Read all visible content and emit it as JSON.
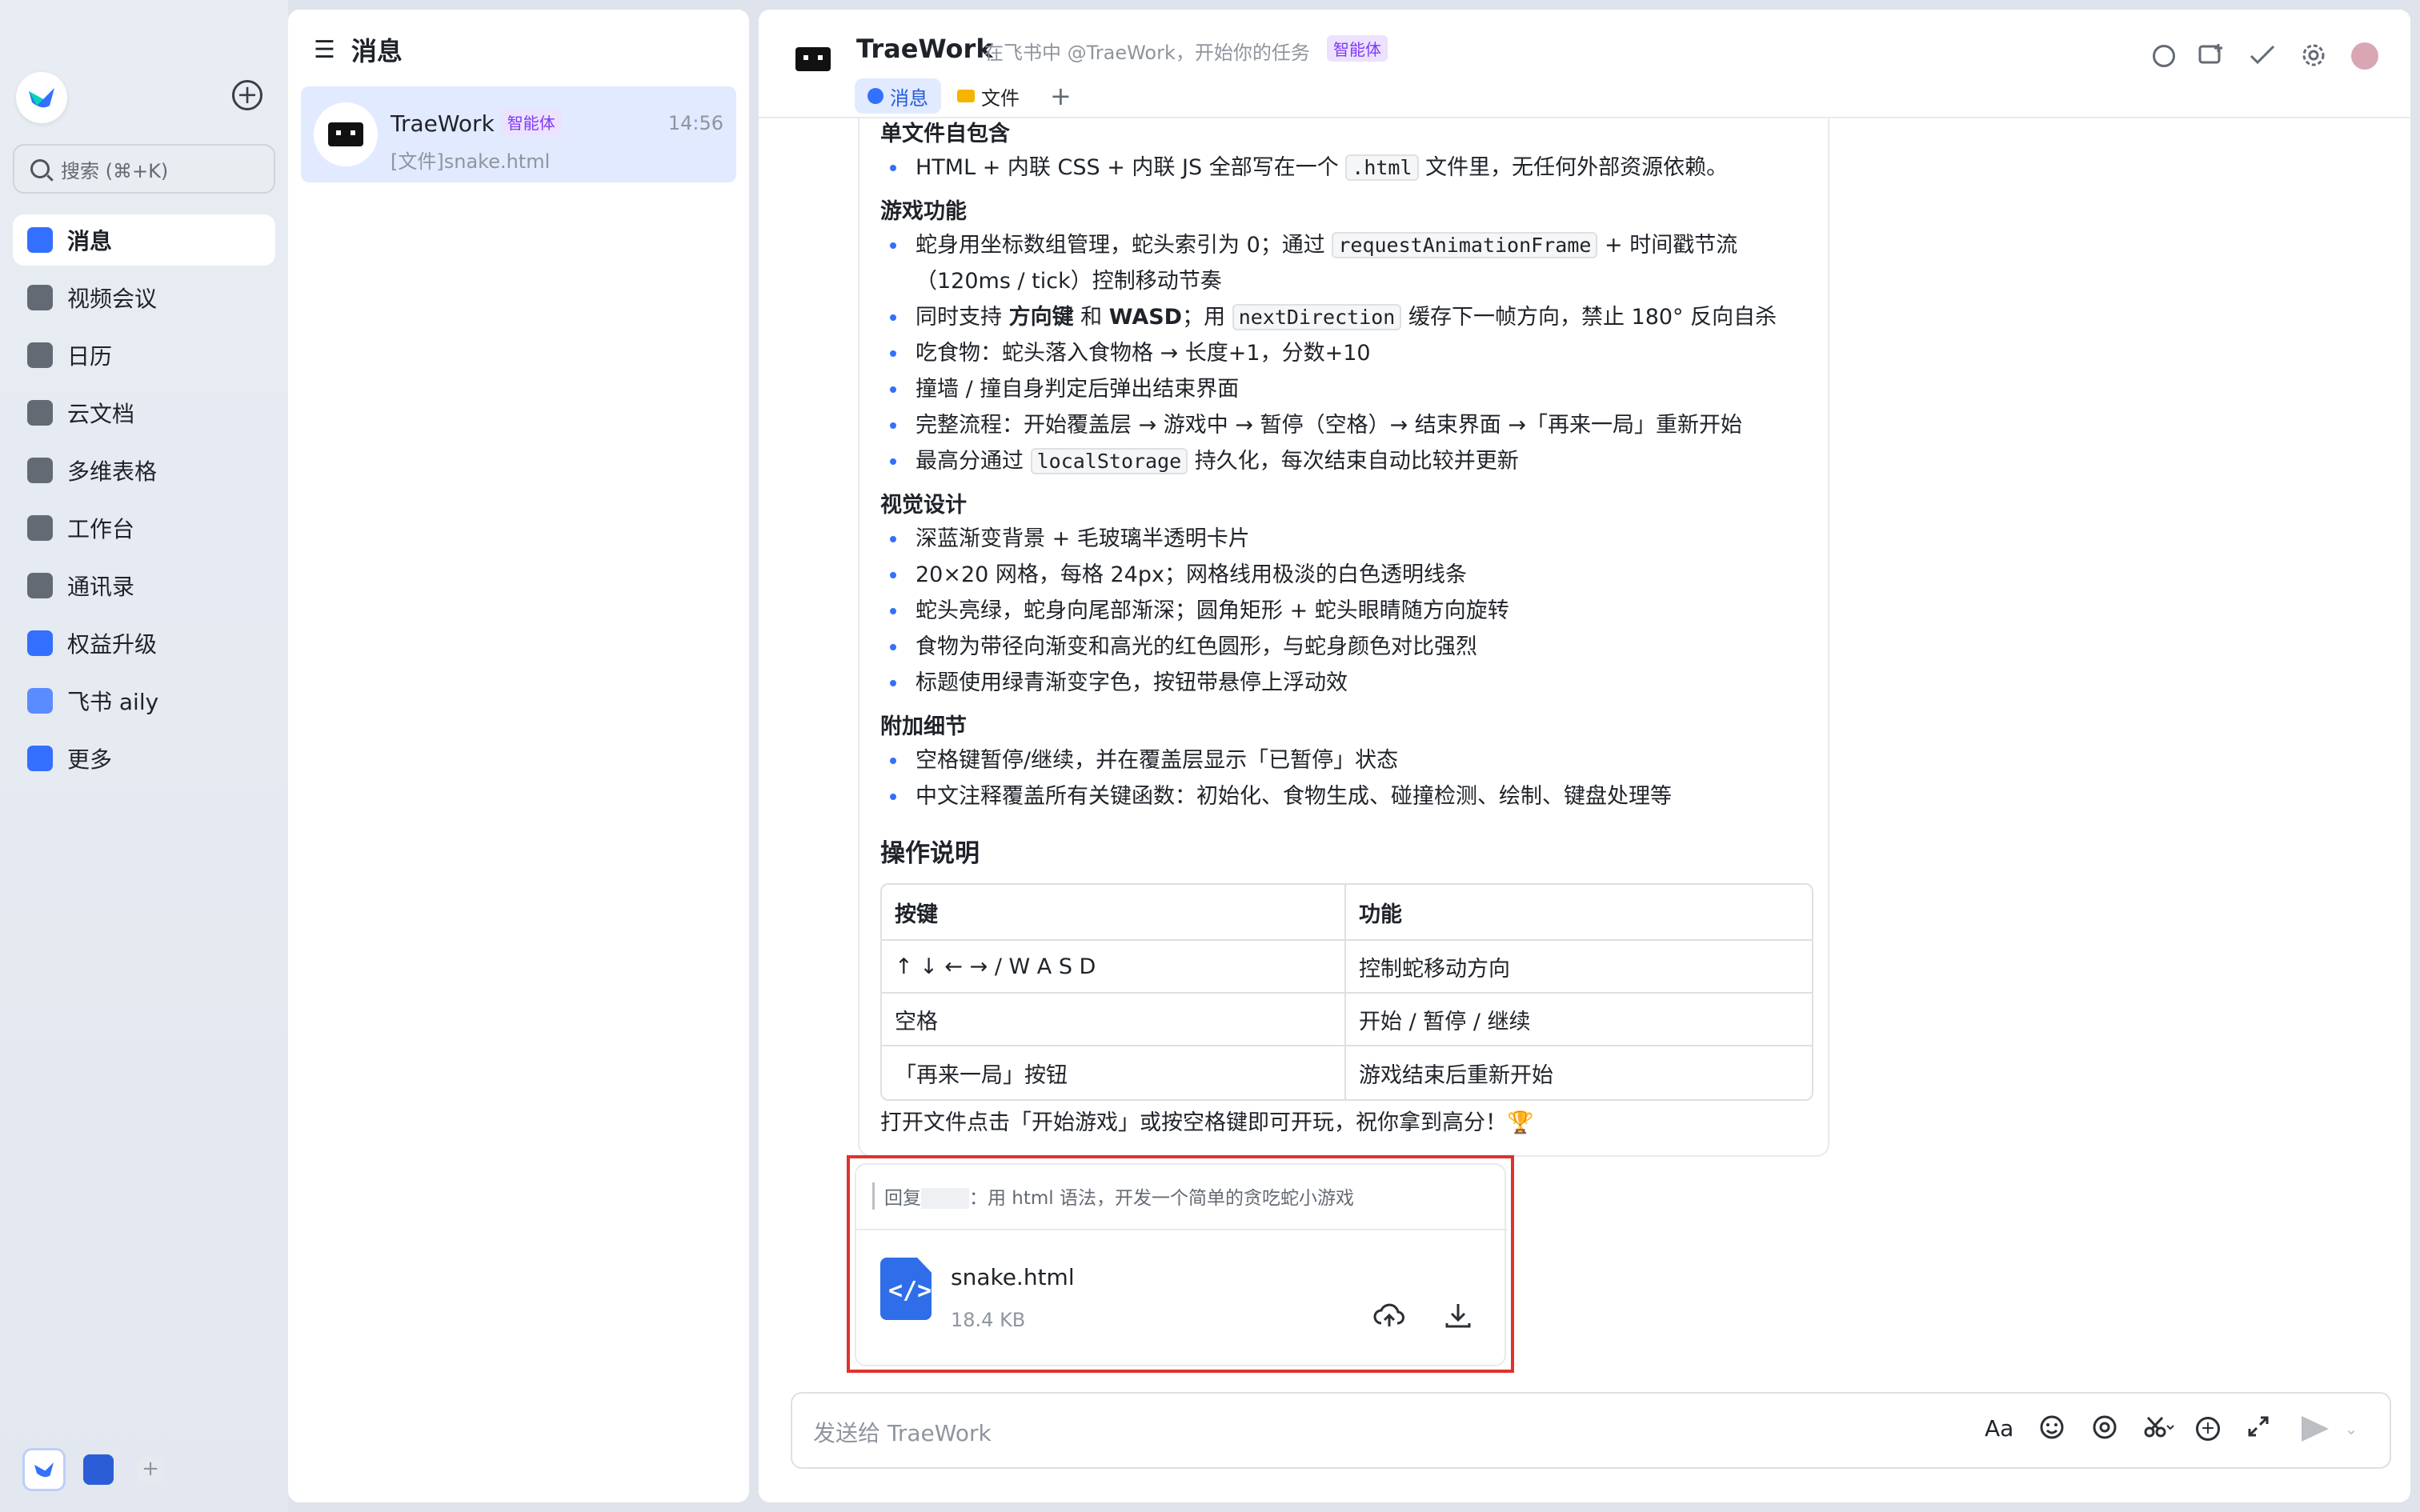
{
  "sidebar": {
    "search_placeholder": "搜索 (⌘+K)",
    "items": [
      {
        "label": "消息",
        "icon": "chat-bubble-icon",
        "color": "#3370ff"
      },
      {
        "label": "视频会议",
        "icon": "video-camera-icon",
        "color": "#646a73"
      },
      {
        "label": "日历",
        "icon": "calendar-icon",
        "color": "#646a73"
      },
      {
        "label": "云文档",
        "icon": "cloud-doc-icon",
        "color": "#646a73"
      },
      {
        "label": "多维表格",
        "icon": "base-table-icon",
        "color": "#646a73"
      },
      {
        "label": "工作台",
        "icon": "workplace-grid-icon",
        "color": "#646a73"
      },
      {
        "label": "通讯录",
        "icon": "contacts-icon",
        "color": "#646a73"
      },
      {
        "label": "权益升级",
        "icon": "diamond-icon",
        "color": "#3370ff"
      },
      {
        "label": "飞书 aily",
        "icon": "aily-icon",
        "color": "#5b8cff"
      },
      {
        "label": "更多",
        "icon": "more-apps-icon",
        "color": "#3370ff"
      }
    ]
  },
  "chatlist": {
    "title": "消息",
    "items": [
      {
        "name": "TraeWork",
        "tag": "智能体",
        "time": "14:56",
        "preview": "[文件]snake.html"
      }
    ]
  },
  "chat": {
    "title": "TraeWork",
    "subtitle": "在飞书中 @TraeWork，开始你的任务",
    "tag": "智能体",
    "tabs": [
      "消息",
      "文件"
    ],
    "tab_add": "+",
    "message": {
      "sections": [
        {
          "title": "单文件自包含",
          "items": [
            {
              "parts": [
                {
                  "t": "HTML + 内联 CSS + 内联 JS 全部写在一个 "
                },
                {
                  "code": ".html"
                },
                {
                  "t": " 文件里，无任何外部资源依赖。"
                }
              ]
            }
          ]
        },
        {
          "title": "游戏功能",
          "items": [
            {
              "parts": [
                {
                  "t": "蛇身用坐标数组管理，蛇头索引为 0；通过 "
                },
                {
                  "code": "requestAnimationFrame"
                },
                {
                  "t": " + 时间戳节流"
                }
              ]
            },
            {
              "cont": "（120ms / tick）控制移动节奏"
            },
            {
              "parts": [
                {
                  "t": "同时支持 "
                },
                {
                  "b": "方向键"
                },
                {
                  "t": " 和 "
                },
                {
                  "b": "WASD"
                },
                {
                  "t": "；用 "
                },
                {
                  "code": "nextDirection"
                },
                {
                  "t": " 缓存下一帧方向，禁止 180° 反向自杀"
                }
              ]
            },
            {
              "parts": [
                {
                  "t": "吃食物：蛇头落入食物格 → 长度+1，分数+10"
                }
              ]
            },
            {
              "parts": [
                {
                  "t": "撞墙 / 撞自身判定后弹出结束界面"
                }
              ]
            },
            {
              "parts": [
                {
                  "t": "完整流程：开始覆盖层 → 游戏中 → 暂停（空格）→ 结束界面 →「再来一局」重新开始"
                }
              ]
            },
            {
              "parts": [
                {
                  "t": "最高分通过 "
                },
                {
                  "code": "localStorage"
                },
                {
                  "t": " 持久化，每次结束自动比较并更新"
                }
              ]
            }
          ]
        },
        {
          "title": "视觉设计",
          "items": [
            {
              "parts": [
                {
                  "t": "深蓝渐变背景 + 毛玻璃半透明卡片"
                }
              ]
            },
            {
              "parts": [
                {
                  "t": "20×20 网格，每格 24px；网格线用极淡的白色透明线条"
                }
              ]
            },
            {
              "parts": [
                {
                  "t": "蛇头亮绿，蛇身向尾部渐深；圆角矩形 + 蛇头眼睛随方向旋转"
                }
              ]
            },
            {
              "parts": [
                {
                  "t": "食物为带径向渐变和高光的红色圆形，与蛇身颜色对比强烈"
                }
              ]
            },
            {
              "parts": [
                {
                  "t": "标题使用绿青渐变字色，按钮带悬停上浮动效"
                }
              ]
            }
          ]
        },
        {
          "title": "附加细节",
          "items": [
            {
              "parts": [
                {
                  "t": "空格键暂停/继续，并在覆盖层显示「已暂停」状态"
                }
              ]
            },
            {
              "parts": [
                {
                  "t": "中文注释覆盖所有关键函数：初始化、食物生成、碰撞检测、绘制、键盘处理等"
                }
              ]
            }
          ]
        }
      ],
      "ops_title": "操作说明",
      "table": {
        "headers": [
          "按键",
          "功能"
        ],
        "rows": [
          [
            "↑ ↓ ← → / W A S D",
            "控制蛇移动方向"
          ],
          [
            "空格",
            "开始 / 暂停 / 继续"
          ],
          [
            "「再来一局」按钮",
            "游戏结束后重新开始"
          ]
        ]
      },
      "closing": "打开文件点击「开始游戏」或按空格键即可开玩，祝你拿到高分！🏆"
    },
    "file": {
      "reply_prefix": "回复",
      "reply_text": "：用 html 语法，开发一个简单的贪吃蛇小游戏",
      "name": "snake.html",
      "size": "18.4 KB"
    },
    "input_placeholder": "发送给 TraeWork",
    "input_font_label": "Aa"
  }
}
